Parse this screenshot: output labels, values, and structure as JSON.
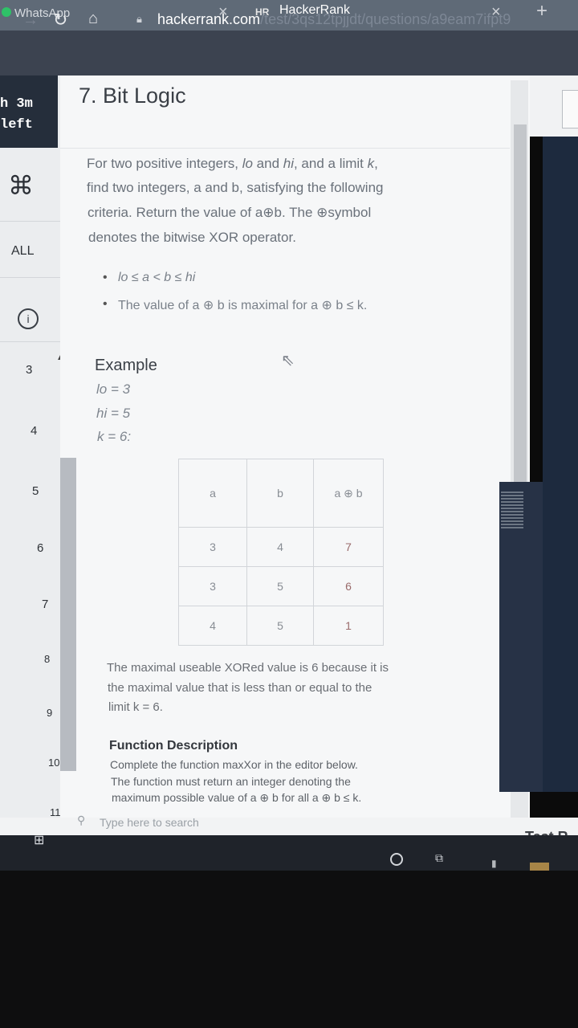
{
  "browser": {
    "tabs": [
      {
        "label": "WhatsApp"
      },
      {
        "label": "HackerRank"
      }
    ],
    "tab_close_glyph": "×",
    "new_tab_glyph": "+",
    "url_host": "hackerrank.com",
    "url_path": "/test/3qs12tpjjdt/questions/a9eam7ifpt9"
  },
  "sidebar": {
    "timer_line1": "h 3m",
    "timer_line2": "left",
    "command_glyph": "⌘",
    "all_label": "ALL",
    "info_glyph": "i",
    "questions": [
      "3",
      "4",
      "5",
      "6",
      "7",
      "8",
      "9",
      "10",
      "11"
    ]
  },
  "question": {
    "title": "7. Bit Logic",
    "intro": [
      {
        "pre": "For two positive integers, ",
        "em1": "lo",
        "mid": " and ",
        "em2": "hi",
        "post": ", and a limit ",
        "em3": "k",
        "end": ","
      },
      {
        "text": "find two integers, a and b, satisfying the following"
      },
      {
        "text": "criteria. Return the value of a⊕b. The ⊕symbol"
      },
      {
        "text": "denotes the bitwise XOR operator."
      }
    ],
    "bullets": [
      "lo ≤ a < b ≤ hi",
      "The value of a ⊕ b is maximal for a ⊕ b ≤ k."
    ],
    "example_heading": "Example",
    "example_values": [
      "lo = 3",
      "hi = 5",
      "k = 6:"
    ],
    "table": {
      "headers": [
        "a",
        "b",
        "a ⊕ b"
      ],
      "rows": [
        [
          "3",
          "4",
          "7"
        ],
        [
          "3",
          "5",
          "6"
        ],
        [
          "4",
          "5",
          "1"
        ]
      ]
    },
    "explanation": [
      "The maximal useable XORed value is 6 because it is",
      "the maximal value that is less than or equal to the",
      "limit k = 6."
    ],
    "function_heading": "Function Description",
    "function_lines": [
      "Complete the function maxXor in the editor below.",
      "The function must return an integer denoting the",
      "maximum possible value of a ⊕ b for all a ⊕ b ≤ k."
    ]
  },
  "editor": {
    "test_run_label": "Test R"
  },
  "taskbar": {
    "search_placeholder": "Type here to search"
  }
}
